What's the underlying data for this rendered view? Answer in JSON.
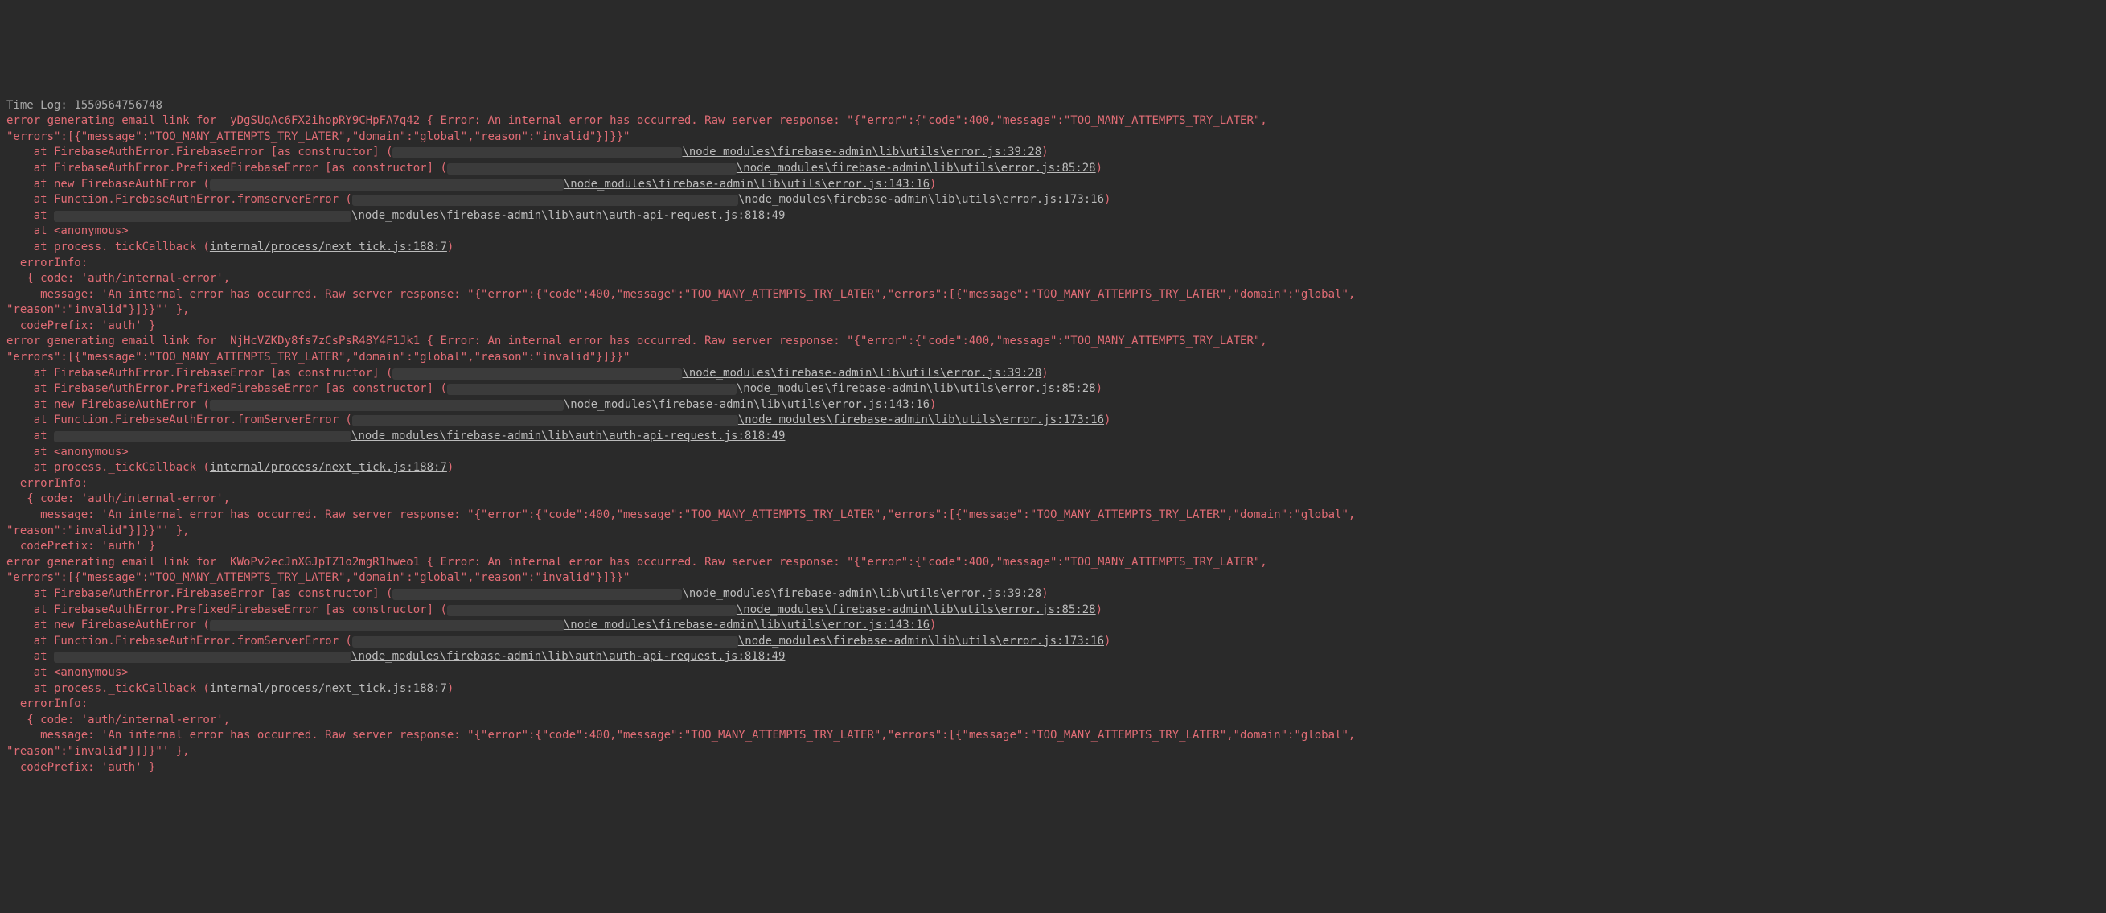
{
  "timelog_label": "Time Log:",
  "timelog_value": "1550564756748",
  "blocks": [
    {
      "uid": "yDgSUqAc6FX2ihopRY9CHpFA7q42",
      "server_label": "fromserverError"
    },
    {
      "uid": "NjHcVZKDy8fs7zCsPsR48Y4F1Jk1",
      "server_label": "fromServerError"
    },
    {
      "uid": "KWoPv2ecJnXGJpTZ1o2mgR1hweo1",
      "server_label": "fromServerError"
    }
  ],
  "err_prefix": "error generating email link for  ",
  "err_open": " { Error: An internal error has occurred. Raw server response: \"{\"error\":{\"code\":400,\"message\":\"TOO_MANY_ATTEMPTS_TRY_LATER\",",
  "err_line2": "\"errors\":[{\"message\":\"TOO_MANY_ATTEMPTS_TRY_LATER\",\"domain\":\"global\",\"reason\":\"invalid\"}]}}\"",
  "stack": {
    "s1_a": "    at FirebaseAuthError.FirebaseError [as constructor] (",
    "s1_b": "\\node_modules\\firebase-admin\\lib\\utils\\error.js:39:28",
    "s2_a": "    at FirebaseAuthError.PrefixedFirebaseError [as constructor] (",
    "s2_b": "\\node_modules\\firebase-admin\\lib\\utils\\error.js:85:28",
    "s3_a": "    at new FirebaseAuthError (",
    "s3_b": "\\node_modules\\firebase-admin\\lib\\utils\\error.js:143:16",
    "s4_a": "    at Function.FirebaseAuthError.",
    "s4_b": " (",
    "s4_c": "\\node_modules\\firebase-admin\\lib\\utils\\error.js:173:16",
    "s5_a": "    at ",
    "s5_b": "\\node_modules\\firebase-admin\\lib\\auth\\auth-api-request.js:818:49",
    "s6": "    at <anonymous>",
    "s7_a": "    at process._tickCallback (",
    "s7_b": "internal/process/next_tick.js:188:7"
  },
  "info": {
    "l1": "  errorInfo:",
    "l2": "   { code: 'auth/internal-error',",
    "l3": "     message: 'An internal error has occurred. Raw server response: \"{\"error\":{\"code\":400,\"message\":\"TOO_MANY_ATTEMPTS_TRY_LATER\",\"errors\":[{\"message\":\"TOO_MANY_ATTEMPTS_TRY_LATER\",\"domain\":\"global\",",
    "l4": "\"reason\":\"invalid\"}]}}\"' },",
    "l5": "  codePrefix: 'auth' }"
  },
  "paren_close": ")"
}
